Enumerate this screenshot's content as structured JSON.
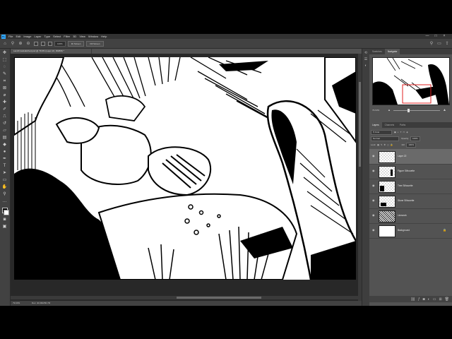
{
  "window": {
    "app_name": "Ps",
    "menu": [
      "File",
      "Edit",
      "Image",
      "Layer",
      "Type",
      "Select",
      "Filter",
      "3D",
      "View",
      "Window",
      "Help"
    ],
    "controls": [
      "—",
      "□",
      "×"
    ]
  },
  "options_bar": {
    "zoom_percent": "100%",
    "fit_screen": "Fit Screen",
    "fill_screen": "Fill Screen"
  },
  "document": {
    "tab_title": "LandCrossHatched.psd @ 79.6% (Layer 22, RGB/8) *",
    "zoom_status": "79.63%",
    "doc_info": "Doc: 40.0M/256.7M"
  },
  "right_panel": {
    "top_tabs": [
      "Swatches",
      "Navigator"
    ],
    "active_top_tab": "Navigator",
    "navigator_zoom": "79.63%",
    "navigator_slider_fraction": 0.32,
    "tabs": [
      "Layers",
      "Channels",
      "Paths"
    ],
    "active_tab": "Layers",
    "filter_label": "Kind",
    "blend_mode": "Normal",
    "opacity_label": "Opacity:",
    "opacity": "100%",
    "lock_label": "Lock:",
    "fill_label": "Fill:",
    "fill": "100%",
    "layers": [
      {
        "name": "Layer 22",
        "selected": true,
        "thumb": "checker"
      },
      {
        "name": "Figure Silhouette",
        "selected": false,
        "thumb": "checker"
      },
      {
        "name": "Tree Silhouette",
        "selected": false,
        "thumb": "checker"
      },
      {
        "name": "Stone Silhouette",
        "selected": false,
        "thumb": "checker"
      },
      {
        "name": "Linework",
        "selected": false,
        "thumb": "art"
      },
      {
        "name": "Background",
        "selected": false,
        "thumb": "white",
        "locked": true
      }
    ]
  },
  "colors": {
    "app_bg": "#535353",
    "panel_bg": "#424242",
    "menubar_bg": "#323232",
    "ps_blue": "#31a8ff",
    "selected_layer": "#6a6a6a"
  }
}
